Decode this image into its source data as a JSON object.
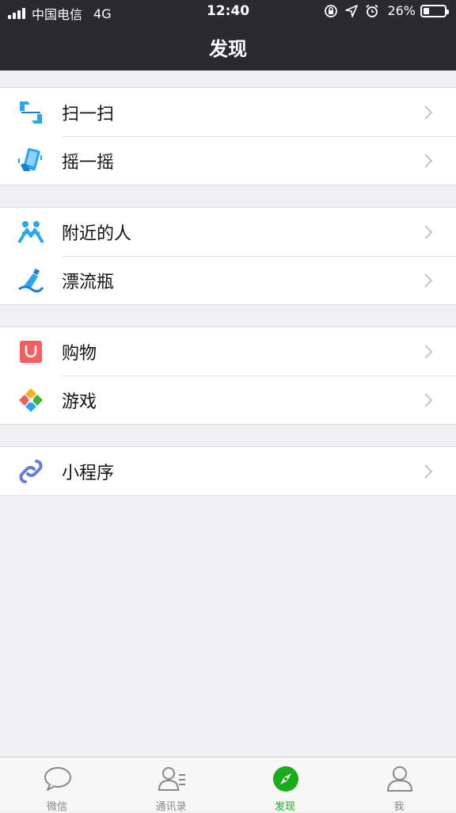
{
  "status_bar": {
    "carrier": "中国电信",
    "network": "4G",
    "time": "12:40",
    "battery": "26%",
    "battery_level": 0.26
  },
  "header": {
    "title": "发现"
  },
  "groups": [
    {
      "items": [
        {
          "label": "扫一扫",
          "icon": "scan-icon"
        },
        {
          "label": "摇一摇",
          "icon": "shake-icon"
        }
      ]
    },
    {
      "items": [
        {
          "label": "附近的人",
          "icon": "people-nearby-icon"
        },
        {
          "label": "漂流瓶",
          "icon": "drift-bottle-icon"
        }
      ]
    },
    {
      "items": [
        {
          "label": "购物",
          "icon": "shopping-icon"
        },
        {
          "label": "游戏",
          "icon": "games-icon"
        }
      ]
    },
    {
      "items": [
        {
          "label": "小程序",
          "icon": "mini-program-icon"
        }
      ]
    }
  ],
  "tabbar": {
    "tabs": [
      {
        "label": "微信",
        "icon": "chat-bubble-icon",
        "active": false
      },
      {
        "label": "通讯录",
        "icon": "contacts-icon",
        "active": false
      },
      {
        "label": "发现",
        "icon": "compass-icon",
        "active": true
      },
      {
        "label": "我",
        "icon": "profile-icon",
        "active": false
      }
    ]
  },
  "colors": {
    "accent": "#1aad19",
    "header_bg": "#2b2b2f",
    "page_bg": "#efeff4"
  }
}
